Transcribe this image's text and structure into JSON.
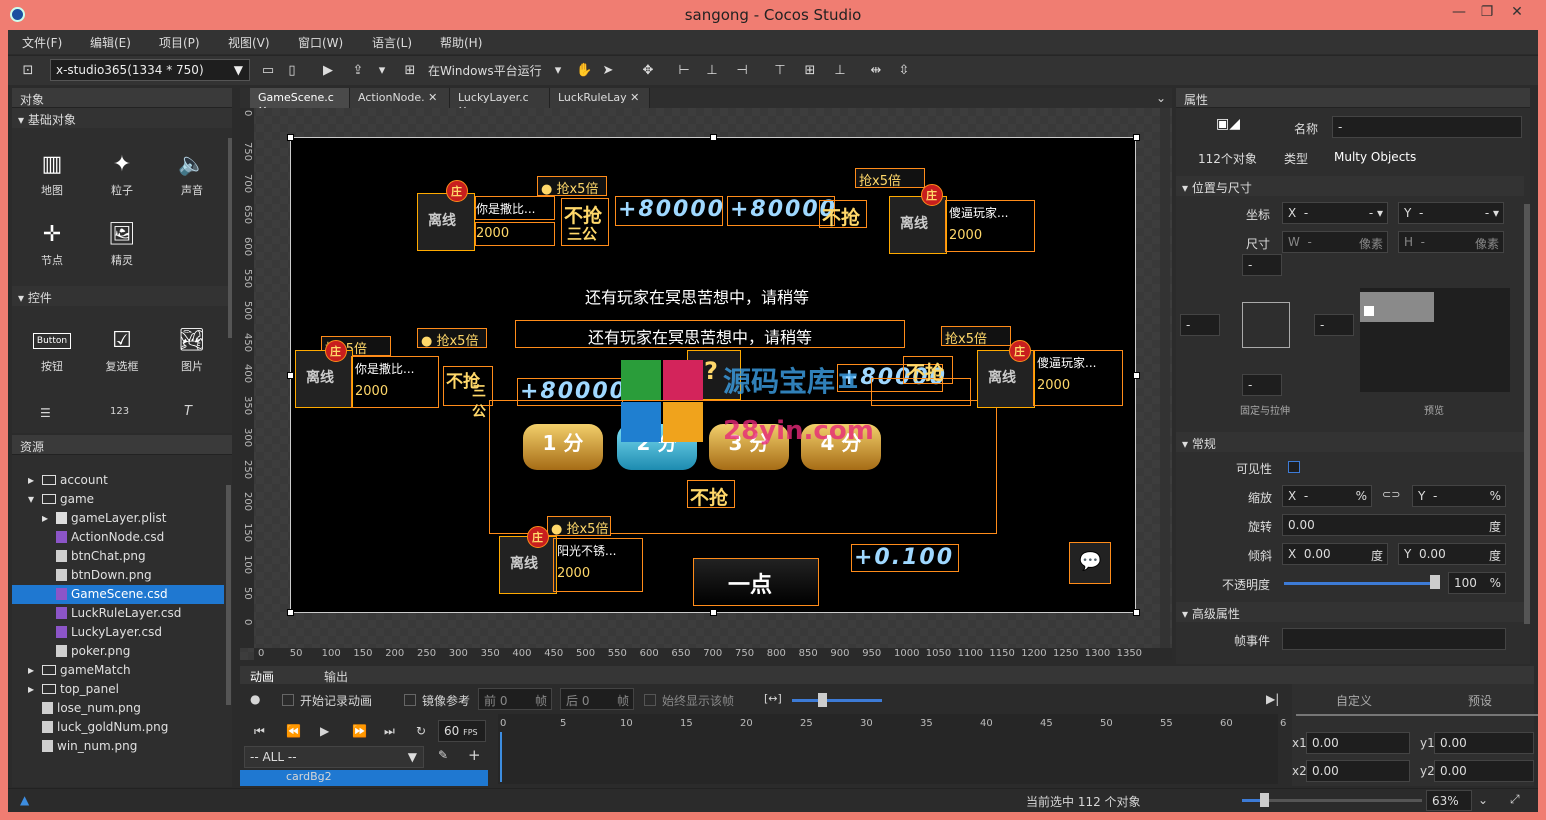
{
  "window": {
    "title": "sangong - Cocos Studio"
  },
  "menu": [
    "文件(F)",
    "编辑(E)",
    "项目(P)",
    "视图(V)",
    "窗口(W)",
    "语言(L)",
    "帮助(H)"
  ],
  "toolbar": {
    "resolution": "x-studio365(1334 * 750)",
    "run_label": "在Windows平台运行"
  },
  "objects_panel": {
    "title": "对象",
    "basic_section": "基础对象",
    "basic_items": [
      "地图",
      "粒子",
      "声音",
      "节点",
      "精灵"
    ],
    "controls_section": "控件",
    "control_items": [
      "按钮",
      "复选框",
      "图片"
    ],
    "button_glyph": "Button",
    "textfield_glyph": "123"
  },
  "resources_panel": {
    "title": "资源",
    "tree": [
      {
        "label": "account",
        "type": "folder",
        "level": 0,
        "arrow": "▸"
      },
      {
        "label": "game",
        "type": "folder",
        "level": 0,
        "arrow": "▾"
      },
      {
        "label": "gameLayer.plist",
        "type": "file",
        "level": 1,
        "arrow": "▸"
      },
      {
        "label": "ActionNode.csd",
        "type": "csd",
        "level": 1,
        "arrow": ""
      },
      {
        "label": "btnChat.png",
        "type": "png",
        "level": 1,
        "arrow": ""
      },
      {
        "label": "btnDown.png",
        "type": "png",
        "level": 1,
        "arrow": ""
      },
      {
        "label": "GameScene.csd",
        "type": "csd",
        "level": 1,
        "arrow": "",
        "selected": true
      },
      {
        "label": "LuckRuleLayer.csd",
        "type": "csd",
        "level": 1,
        "arrow": ""
      },
      {
        "label": "LuckyLayer.csd",
        "type": "csd",
        "level": 1,
        "arrow": ""
      },
      {
        "label": "poker.png",
        "type": "png",
        "level": 1,
        "arrow": ""
      },
      {
        "label": "gameMatch",
        "type": "folder",
        "level": 0,
        "arrow": "▸"
      },
      {
        "label": "top_panel",
        "type": "folder",
        "level": 0,
        "arrow": "▸"
      },
      {
        "label": "lose_num.png",
        "type": "png",
        "level": 0,
        "arrow": ""
      },
      {
        "label": "luck_goldNum.png",
        "type": "png",
        "level": 0,
        "arrow": ""
      },
      {
        "label": "win_num.png",
        "type": "png",
        "level": 0,
        "arrow": ""
      }
    ]
  },
  "tabs": [
    "GameScene.c",
    "ActionNode.",
    "LuckyLayer.c",
    "LuckRuleLay"
  ],
  "scene": {
    "wait_text": "还有玩家在冥思苦想中，请稍等",
    "offline": "离线",
    "banker": "庄",
    "grab_x5": "抢x5倍",
    "no_grab": "不抢",
    "sangong": "三公",
    "name1": "你是撒比...",
    "name2": "傻逼玩家...",
    "name3": "阳光不锈...",
    "gold": "2000",
    "score_big": "+80000",
    "score_small": "+0.100",
    "question": "?",
    "btn1": "1 分",
    "btn2": "2 分",
    "btn3": "3 分",
    "btn4": "4 分",
    "one_point": "一点",
    "chat": "💬"
  },
  "watermark": {
    "line1": "源码宝库ㅍ",
    "line2": "28yin.com"
  },
  "ruler_h": [
    "0",
    "50",
    "100",
    "150",
    "200",
    "250",
    "300",
    "350",
    "400",
    "450",
    "500",
    "550",
    "600",
    "650",
    "700",
    "750",
    "800",
    "850",
    "900",
    "950",
    "1000",
    "1050",
    "1100",
    "1150",
    "1200",
    "1250",
    "1300",
    "1350"
  ],
  "ruler_v": [
    "0",
    "750",
    "700",
    "650",
    "600",
    "550",
    "500",
    "450",
    "400",
    "350",
    "300",
    "250",
    "200",
    "150",
    "100",
    "50",
    "0"
  ],
  "properties": {
    "title": "属性",
    "name_label": "名称",
    "name_value": "-",
    "count_label": "112个对象",
    "type_label": "类型",
    "type_value": "Multy Objects",
    "pos_section": "位置与尺寸",
    "pos_label": "坐标",
    "size_label": "尺寸",
    "x": "X",
    "y": "Y",
    "w": "W",
    "h": "H",
    "dash": "-",
    "pixel": "像素",
    "anchor_label": "固定与拉伸",
    "preview_label": "预览",
    "general_section": "常规",
    "visible_label": "可见性",
    "scale_label": "缩放",
    "rotate_label": "旋转",
    "rotate_value": "0.00",
    "deg": "度",
    "skew_label": "倾斜",
    "skew_x": "0.00",
    "skew_y": "0.00",
    "opacity_label": "不透明度",
    "opacity_value": "100",
    "percent": "%",
    "advanced_section": "高级属性",
    "frame_event_label": "帧事件"
  },
  "animation": {
    "tab_anim": "动画",
    "tab_output": "输出",
    "record_label": "开始记录动画",
    "mirror_label": "镜像参考",
    "front_label": "前",
    "front_value": "0",
    "frame_unit": "帧",
    "back_label": "后",
    "back_value": "0",
    "always_label": "始终显示该帧",
    "fps_value": "60",
    "fps_unit": "FPS",
    "all_label": "-- ALL --",
    "node_label": "cardBg2",
    "custom_tab": "自定义",
    "preset_tab": "预设",
    "x1_label": "x1",
    "x1_value": "0.00",
    "y1_label": "y1",
    "y1_value": "0.00",
    "x2_label": "x2",
    "x2_value": "0.00",
    "y2_label": "y2",
    "y2_value": "0.00",
    "timeline": [
      "0",
      "5",
      "10",
      "15",
      "20",
      "25",
      "30",
      "35",
      "40",
      "45",
      "50",
      "55",
      "60",
      "6"
    ]
  },
  "status": {
    "selection": "当前选中 112 个对象",
    "zoom": "63%"
  }
}
